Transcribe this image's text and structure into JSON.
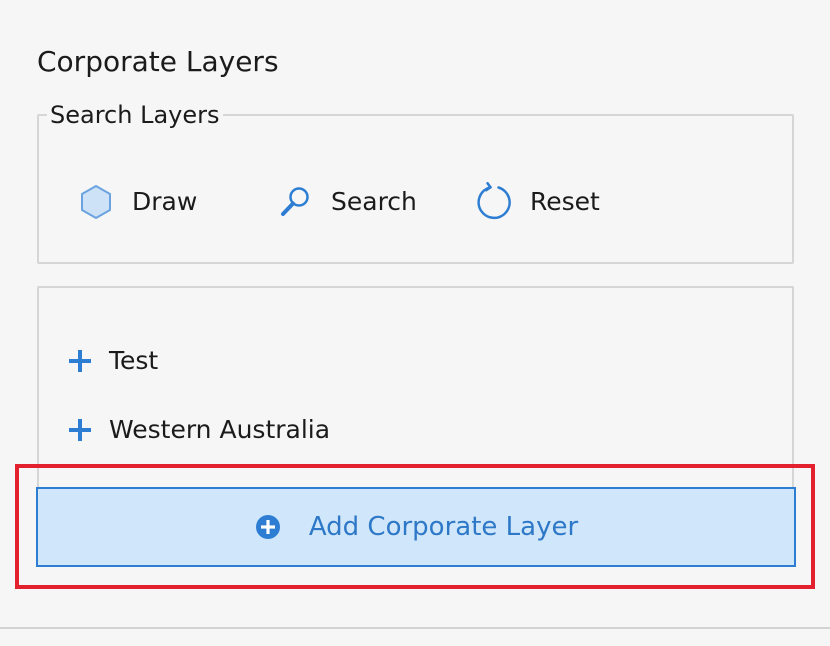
{
  "panel": {
    "title": "Corporate Layers"
  },
  "search_layers": {
    "legend": "Search Layers",
    "tools": [
      {
        "label": "Draw",
        "icon": "hexagon-icon"
      },
      {
        "label": "Search",
        "icon": "magnifier-icon"
      },
      {
        "label": "Reset",
        "icon": "reset-icon"
      }
    ]
  },
  "layer_tree": {
    "items": [
      {
        "label": "Test",
        "icon": "expand-plus-icon"
      },
      {
        "label": "Western Australia",
        "icon": "expand-plus-icon"
      }
    ]
  },
  "add_button": {
    "label": "Add Corporate Layer",
    "icon": "add-circle-icon"
  },
  "colors": {
    "accent": "#2d7dd2",
    "button_fill": "#d0e6fb",
    "highlight": "#e3202d",
    "background": "#f6f6f6"
  }
}
